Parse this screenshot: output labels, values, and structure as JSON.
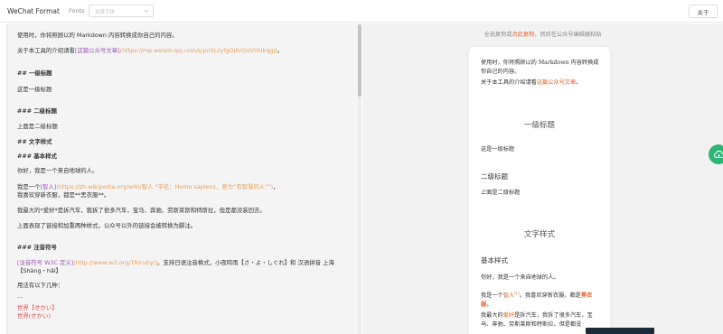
{
  "header": {
    "app_title": "WeChat Format",
    "font_label": "Fonts",
    "font_placeholder": "选择字体",
    "about_label": "关于"
  },
  "editor": {
    "lines": [
      "使用时，你将照顾以的 Markdown 内容转换成你自己的内容。",
      "## 一级标题",
      "这是一级标题",
      "### 二级标题",
      "上面是二级标题",
      "## 文字样式",
      "### 基本样式",
      "你好，我是一个来自地球的人。",
      "我喜欢穿新衣服，都是**黑衣服**。",
      "我最大的*爱好*是拆汽车，我拆了很多汽车，宝马、奔驰、劳斯莱斯和特斯拉，但是都没装回去。",
      "上面表现了链接和加重两种样式，公众号以外的链接会被转换为脚注。",
      "### 注音符号",
      "用法有以下几种：",
      "...",
      "世界【せかい】",
      "世界(せかい)"
    ],
    "intro_prefix": "关于本工具的介绍请看",
    "intro_link_text": "[这篇公众号文章]",
    "intro_link_url": "(https://mp.weixin.qq.com/s/pn0LzyfgOj6rGUVHUkqgj)",
    "intro_suffix": "。",
    "human_prefix": "我是一个",
    "human_link_text": "[智人]",
    "human_link_url": "(https://zh.wikipedia.org/wiki/智人 \"学名：Homo sapiens，意为“有智慧的人”\")",
    "human_suffix": "，",
    "ruby_link_text": "[注音符号 W3C 定义]",
    "ruby_link_url": "(http://www.w3.org/TR/ruby/)",
    "ruby_suffix": "。支持日语注音格式，小夜時雨【さ・よ・しぐれ】和 汉语拼音 上海",
    "ruby_line2": "【Shàng・hǎi】"
  },
  "preview": {
    "copy_prefix": "全选复制或",
    "copy_link": "点此复制",
    "copy_suffix": "，然后在公众号编辑器粘贴",
    "p1": "使用时，你将照顾以的 Markdown 内容转换成你自己的内容。",
    "p2_prefix": "关于本工具的介绍请看",
    "p2_link": "这篇公众号文章",
    "p2_suffix": "。",
    "h1_first": "一级标题",
    "p3": "这是一级标题",
    "h2_second": "二级标题",
    "p4": "上面是二级标题",
    "h1_text_style": "文字样式",
    "h2_basic": "基本样式",
    "p5": "你好，我是一个来自地球的人。",
    "p6_prefix": "我是一个",
    "p6_link": "智人",
    "p6_sup": "[1]",
    "p6_mid": "。我喜欢穿新衣服，都是",
    "p6_bold": "黑衣服",
    "p6_suffix": "。",
    "p7_prefix": "我最大的",
    "p7_em": "爱好",
    "p7_suffix": "是拆汽车，我拆了很多汽车，宝马、奔驰、劳斯莱斯和特斯拉，但是都没"
  },
  "colors": {
    "accent": "#e8602c",
    "link": "#9b59b6",
    "cloud": "#2bb673"
  },
  "icons": {
    "cloud": "cloud-icon",
    "caret": "chevron-down-icon"
  }
}
